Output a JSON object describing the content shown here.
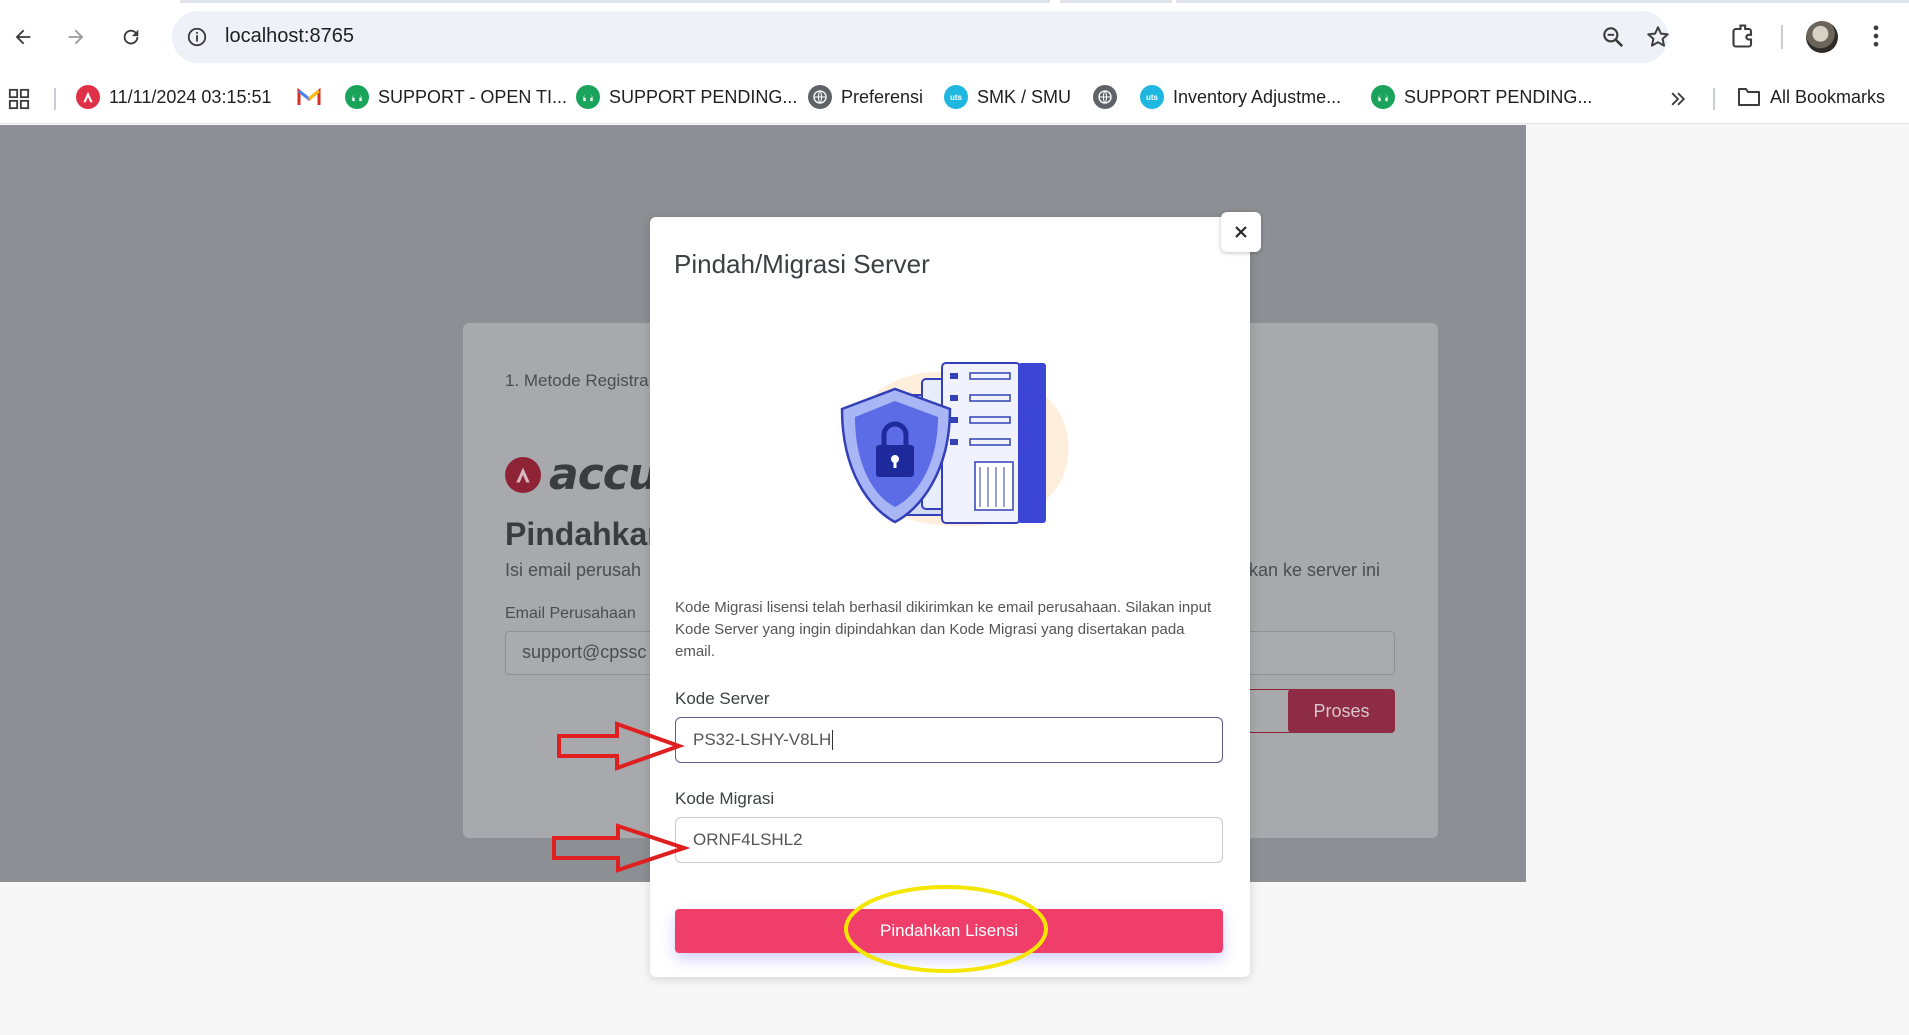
{
  "browser": {
    "url": "localhost:8765",
    "bookmarks": [
      {
        "label": "11/11/2024 03:15:51",
        "icon": "accurate-icon"
      },
      {
        "label": "",
        "icon": "gmail-icon"
      },
      {
        "label": "SUPPORT - OPEN TI...",
        "icon": "support-icon"
      },
      {
        "label": "SUPPORT PENDING...",
        "icon": "support-icon"
      },
      {
        "label": "Preferensi",
        "icon": "globe-icon"
      },
      {
        "label": "SMK / SMU",
        "icon": "uts-icon"
      },
      {
        "label": "",
        "icon": "globe-icon"
      },
      {
        "label": "Inventory Adjustme...",
        "icon": "uts-icon"
      },
      {
        "label": "SUPPORT PENDING...",
        "icon": "support-icon"
      }
    ],
    "all_bookmarks_label": "All Bookmarks"
  },
  "background_page": {
    "step_label": "1. Metode Registra",
    "brand_text": "accura",
    "title": "Pindahkan",
    "desc_left": "Isi email perusah",
    "desc_right": "kan ke server ini",
    "email_label": "Email Perusahaan",
    "email_value": "support@cpssc",
    "proses_label": "Proses"
  },
  "modal": {
    "title": "Pindah/Migrasi Server",
    "description": "Kode Migrasi lisensi telah berhasil dikirimkan ke email perusahaan. Silakan input Kode Server yang ingin dipindahkan dan Kode Migrasi yang disertakan pada email.",
    "server_code_label": "Kode Server",
    "server_code_value": "PS32-LSHY-V8LH",
    "migration_code_label": "Kode Migrasi",
    "migration_code_value": "ORNF4LSHL2",
    "submit_label": "Pindahkan Lisensi"
  },
  "colors": {
    "accent": "#ef3e6a",
    "annotation_arrow": "#e02020",
    "annotation_circle": "#f5e600"
  }
}
